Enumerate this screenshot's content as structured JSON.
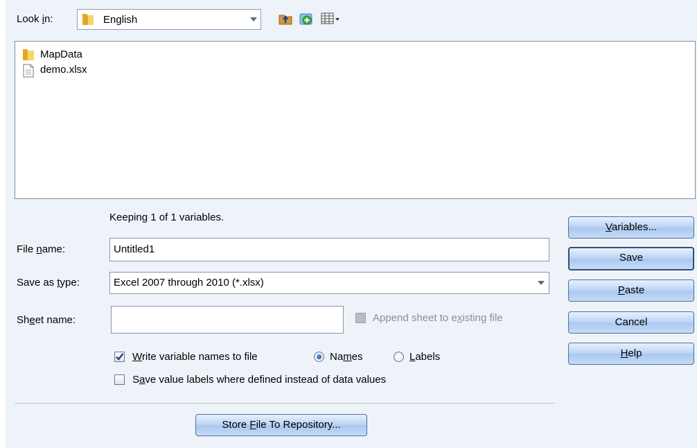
{
  "look_in": {
    "label_pre": "Look ",
    "label_key": "i",
    "label_post": "n:",
    "value": "English"
  },
  "toolbar_icons": [
    "up-folder-icon",
    "new-folder-icon",
    "view-menu-icon"
  ],
  "files": [
    {
      "name": "MapData",
      "icon": "folder-icon"
    },
    {
      "name": "demo.xlsx",
      "icon": "document-icon"
    }
  ],
  "status_text": "Keeping 1 of 1 variables.",
  "file_name": {
    "label_pre": "File ",
    "label_key": "n",
    "label_post": "ame:",
    "value": "Untitled1"
  },
  "save_as_type": {
    "label_pre": "Save as ",
    "label_key": "t",
    "label_post": "ype:",
    "value": "Excel 2007 through 2010 (*.xlsx)"
  },
  "sheet_name": {
    "label_pre": "Sh",
    "label_key": "e",
    "label_post": "et name:",
    "value": ""
  },
  "append_sheet": {
    "label_pre": "Append sheet to e",
    "label_key": "x",
    "label_post": "isting file",
    "checked": false,
    "enabled": false
  },
  "write_names": {
    "label_key": "W",
    "label_post": "rite variable names to file",
    "checked": true
  },
  "radio_names": {
    "label_pre": "Na",
    "label_key": "m",
    "label_post": "es",
    "selected": true
  },
  "radio_labels": {
    "label_key": "L",
    "label_post": "abels",
    "selected": false
  },
  "save_value_labels": {
    "label_pre": "S",
    "label_key": "a",
    "label_post": "ve value labels where defined instead of data values",
    "checked": false
  },
  "buttons": {
    "variables": {
      "key": "V",
      "rest": "ariables..."
    },
    "save": {
      "label": "Save"
    },
    "paste": {
      "key": "P",
      "rest": "aste"
    },
    "cancel": {
      "label": "Cancel"
    },
    "help": {
      "key": "H",
      "rest": "elp"
    },
    "store": {
      "pre": "Store ",
      "key": "F",
      "rest": "ile To Repository..."
    }
  },
  "colors": {
    "dialog_bg": "#eef3fa",
    "button_border": "#4d6f98",
    "check_blue": "#1f3f91"
  }
}
